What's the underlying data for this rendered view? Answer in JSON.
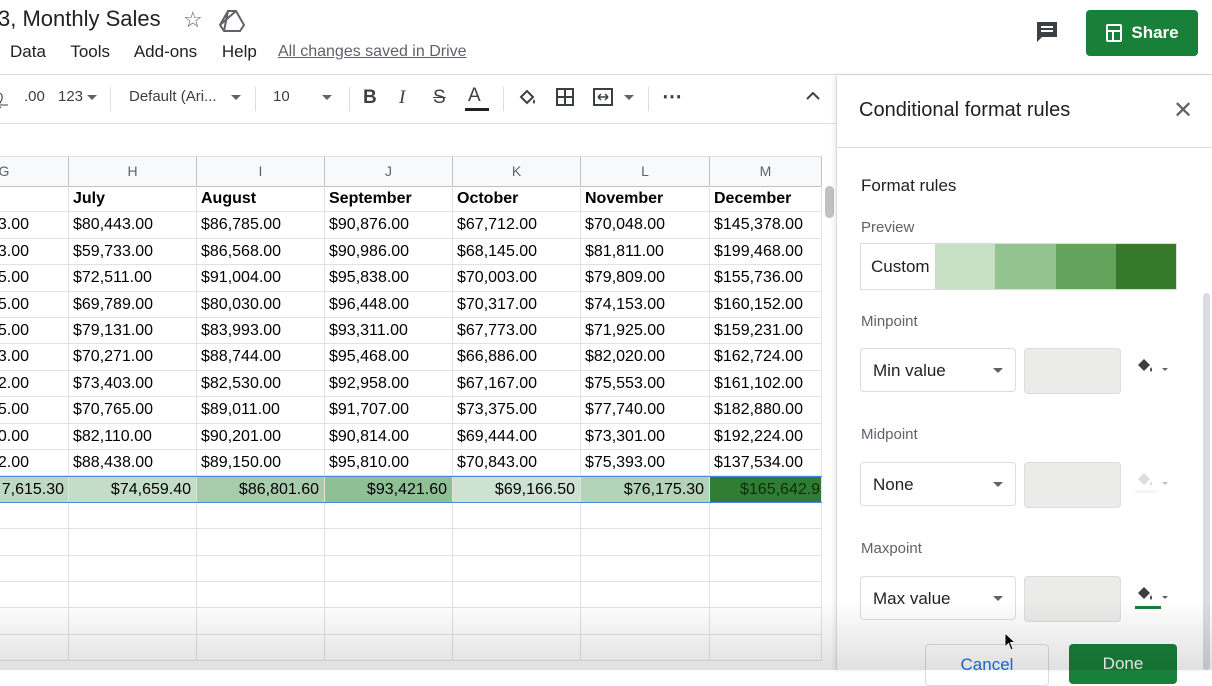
{
  "header": {
    "doc_title": "3, Monthly Sales",
    "menus": [
      "Data",
      "Tools",
      "Add-ons",
      "Help"
    ],
    "saved_status": "All changes saved in Drive",
    "share_label": "Share"
  },
  "toolbar": {
    "decimal_increase": ".00",
    "more_formats": "123",
    "font_family": "Default (Ari...",
    "font_size": "10",
    "bold": "B",
    "italic": "I",
    "strike": "S",
    "text_color": "A",
    "more": "⋯"
  },
  "sheet": {
    "column_letters": [
      "G",
      "H",
      "I",
      "J",
      "K",
      "L",
      "M"
    ],
    "header_row": [
      "",
      "July",
      "August",
      "September",
      "October",
      "November",
      "December"
    ],
    "rows": [
      [
        "3.00",
        "$80,443.00",
        "$86,785.00",
        "$90,876.00",
        "$67,712.00",
        "$70,048.00",
        "$145,378.00"
      ],
      [
        "3.00",
        "$59,733.00",
        "$86,568.00",
        "$90,986.00",
        "$68,145.00",
        "$81,811.00",
        "$199,468.00"
      ],
      [
        "5.00",
        "$72,511.00",
        "$91,004.00",
        "$95,838.00",
        "$70,003.00",
        "$79,809.00",
        "$155,736.00"
      ],
      [
        "5.00",
        "$69,789.00",
        "$80,030.00",
        "$96,448.00",
        "$70,317.00",
        "$74,153.00",
        "$160,152.00"
      ],
      [
        "5.00",
        "$79,131.00",
        "$83,993.00",
        "$93,311.00",
        "$67,773.00",
        "$71,925.00",
        "$159,231.00"
      ],
      [
        "3.00",
        "$70,271.00",
        "$88,744.00",
        "$95,468.00",
        "$66,886.00",
        "$82,020.00",
        "$162,724.00"
      ],
      [
        "2.00",
        "$73,403.00",
        "$82,530.00",
        "$92,958.00",
        "$67,167.00",
        "$75,553.00",
        "$161,102.00"
      ],
      [
        "5.00",
        "$70,765.00",
        "$89,011.00",
        "$91,707.00",
        "$73,375.00",
        "$77,740.00",
        "$182,880.00"
      ],
      [
        "0.00",
        "$82,110.00",
        "$90,201.00",
        "$90,814.00",
        "$69,444.00",
        "$73,301.00",
        "$192,224.00"
      ],
      [
        "2.00",
        "$88,438.00",
        "$89,150.00",
        "$95,810.00",
        "$70,843.00",
        "$75,393.00",
        "$137,534.00"
      ]
    ],
    "totals_row": [
      "7,615.30",
      "$74,659.40",
      "$86,801.60",
      "$93,421.60",
      "$69,166.50",
      "$76,175.30",
      "$165,642.9"
    ],
    "totals_colors": [
      "#bdd9c4",
      "#c4ddc9",
      "#a6ccab",
      "#8fbf95",
      "#cde2d0",
      "#b3d3b8",
      "#2e7d32"
    ]
  },
  "panel": {
    "title": "Conditional format rules",
    "section_title": "Format rules",
    "preview_label": "Preview",
    "preview_text": "Custom",
    "preview_colors": [
      "#c6dfc5",
      "#93c48f",
      "#63a35c",
      "#347a2a"
    ],
    "minpoint_label": "Minpoint",
    "minpoint_value": "Min value",
    "midpoint_label": "Midpoint",
    "midpoint_value": "None",
    "maxpoint_label": "Maxpoint",
    "maxpoint_value": "Max value",
    "min_color": "#ffffff",
    "mid_color": "#d9ead3",
    "max_color": "#188038",
    "cancel_label": "Cancel",
    "done_label": "Done"
  },
  "colors": {
    "accent_green": "#188038",
    "link_blue": "#1a73e8"
  }
}
